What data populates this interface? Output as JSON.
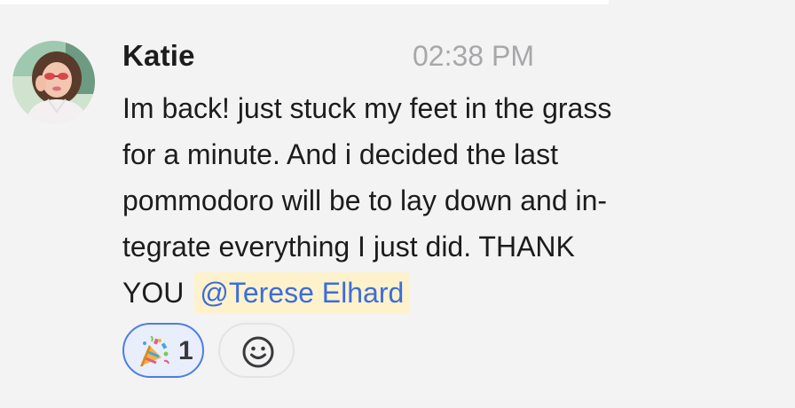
{
  "message": {
    "author": "Katie",
    "timestamp": "02:38 PM",
    "lines": [
      "Im back! just stuck my feet in the grass",
      "for a minute. And i decided the last",
      "pommodoro will be to lay down and in-",
      "tegrate everything I just did. THANK",
      "YOU"
    ],
    "mention": "@Terese Elhard",
    "avatar_icon": "user-avatar-photo"
  },
  "reactions": [
    {
      "emoji_icon": "party-popper-icon",
      "count": "1",
      "selected": true
    }
  ],
  "add_reaction_icon": "smiley-add-icon",
  "colors": {
    "background": "#f3f3f4",
    "author_text": "#1d1c1d",
    "timestamp_text": "#a7a7aa",
    "mention_text": "#3c6ddc",
    "mention_highlight": "#fdf2cc",
    "reaction_selected_border": "#4a7ee6",
    "reaction_selected_bg": "#e9eefc"
  }
}
